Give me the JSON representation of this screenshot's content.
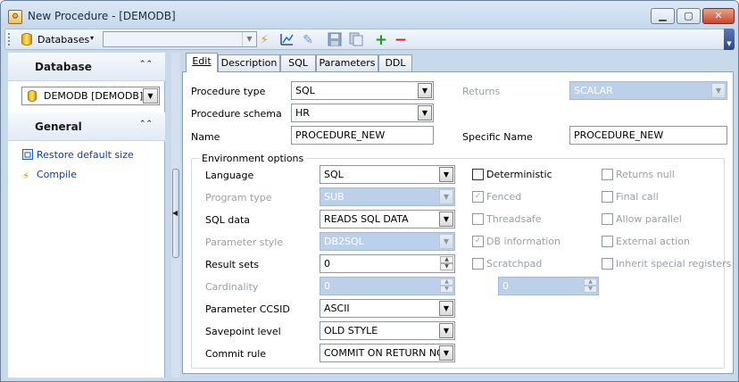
{
  "window": {
    "title": "New Procedure - [DEMODB]",
    "app_icon": "procedure-editor-icon",
    "controls": {
      "minimize": "▁",
      "maximize": "▢",
      "close": "✕"
    }
  },
  "toolbar": {
    "database_label": "Databases",
    "database_dropdown": "▾",
    "combo_value": "",
    "icons": [
      "database-icon",
      "lightning-icon",
      "chart-icon",
      "edit-icon",
      "save-icon",
      "copy-icon",
      "add-icon",
      "remove-icon"
    ]
  },
  "sidebar": {
    "database_header": "Database",
    "database_value": "DEMODB [DEMODB]",
    "general_header": "General",
    "links": [
      {
        "label": "Restore default size",
        "icon": "restore-size-icon"
      },
      {
        "label": "Compile",
        "icon": "compile-lightning-icon"
      }
    ]
  },
  "tabs": [
    {
      "label": "Edit",
      "active": true
    },
    {
      "label": "Description",
      "active": false
    },
    {
      "label": "SQL",
      "active": false
    },
    {
      "label": "Parameters",
      "active": false
    },
    {
      "label": "DDL",
      "active": false
    }
  ],
  "form": {
    "procedure_type_label": "Procedure type",
    "procedure_type_value": "SQL",
    "procedure_schema_label": "Procedure schema",
    "procedure_schema_value": "HR",
    "name_label": "Name",
    "name_value": "PROCEDURE_NEW",
    "returns_label": "Returns",
    "returns_value": "SCALAR",
    "specific_name_label": "Specific Name",
    "specific_name_value": "PROCEDURE_NEW"
  },
  "environment": {
    "title": "Environment options",
    "language_label": "Language",
    "language_value": "SQL",
    "program_type_label": "Program type",
    "program_type_value": "SUB",
    "sql_data_label": "SQL data",
    "sql_data_value": "READS SQL DATA",
    "parameter_style_label": "Parameter style",
    "parameter_style_value": "DB2SQL",
    "result_sets_label": "Result sets",
    "result_sets_value": "0",
    "cardinality_label": "Cardinality",
    "cardinality_value": "0",
    "parameter_ccsid_label": "Parameter CCSID",
    "parameter_ccsid_value": "ASCII",
    "savepoint_level_label": "Savepoint level",
    "savepoint_level_value": "OLD STYLE",
    "commit_rule_label": "Commit rule",
    "commit_rule_value": "COMMIT ON RETURN NO",
    "scratchpad_value": "0",
    "checkboxes": {
      "deterministic": "Deterministic",
      "fenced": "Fenced",
      "threadsafe": "Threadsafe",
      "db_information": "DB information",
      "scratchpad": "Scratchpad",
      "returns_null": "Returns null",
      "final_call": "Final call",
      "allow_parallel": "Allow parallel",
      "external_action": "External action",
      "inherit_special_registers": "Inherit special registers"
    }
  }
}
